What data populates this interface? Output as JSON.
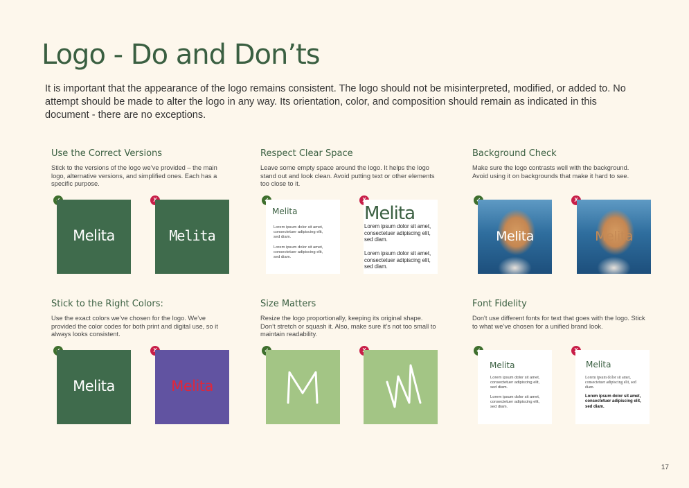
{
  "page": {
    "title": "Logo  - Do and Don’ts",
    "intro": "It is important that the appearance of the logo remains consistent. The logo should not be misinterpreted, modified, or added to. No attempt should be made to alter the logo in any way. Its orientation,  color, and composition should remain as indicated in this document - there are no exceptions.",
    "page_number": "17"
  },
  "badges": {
    "ok": "✓",
    "no": "X"
  },
  "logo": {
    "text": "Melita",
    "monogram": "M"
  },
  "colors": {
    "green": "#3f6b4c",
    "purple": "#6153a1",
    "lime": "#a3c585",
    "ok": "#3f6f2e",
    "no": "#c81e48",
    "bad_red": "#e0263a"
  },
  "sections": [
    {
      "title": "Use the Correct Versions",
      "desc": "Stick to the versions of the logo we’ve provided – the main logo, alternative versions, and simplified ones. Each has a specific purpose."
    },
    {
      "title": "Respect Clear Space",
      "desc": "Leave some empty space around the logo. It helps the logo stand out and look clean. Avoid putting text or other elements too close to it."
    },
    {
      "title": "Background Check",
      "desc": "Make sure the logo contrasts well with the background. Avoid using it on backgrounds that make it hard to see."
    },
    {
      "title": "Stick to the Right Colors:",
      "desc": "Use the exact colors we’ve chosen for the logo. We’ve provided the color codes for both print and digital use, so it always looks consistent."
    },
    {
      "title": "Size Matters",
      "desc": "Resize the logo proportionally, keeping its original shape. Don’t stretch or squash it. Also, make sure it’s not too small to maintain readability."
    },
    {
      "title": "Font Fidelity",
      "desc": "Don't use different fonts for text that goes with the logo. Stick to what we’ve chosen for a unified brand look."
    }
  ],
  "sample": {
    "line1": "Lorem ipsum dolor sit amet, consectetuer adipiscing elit, sed diam.",
    "line2": "Lorem ipsum dolor sit amet, consectetuer adipiscing elit, sed diam."
  }
}
